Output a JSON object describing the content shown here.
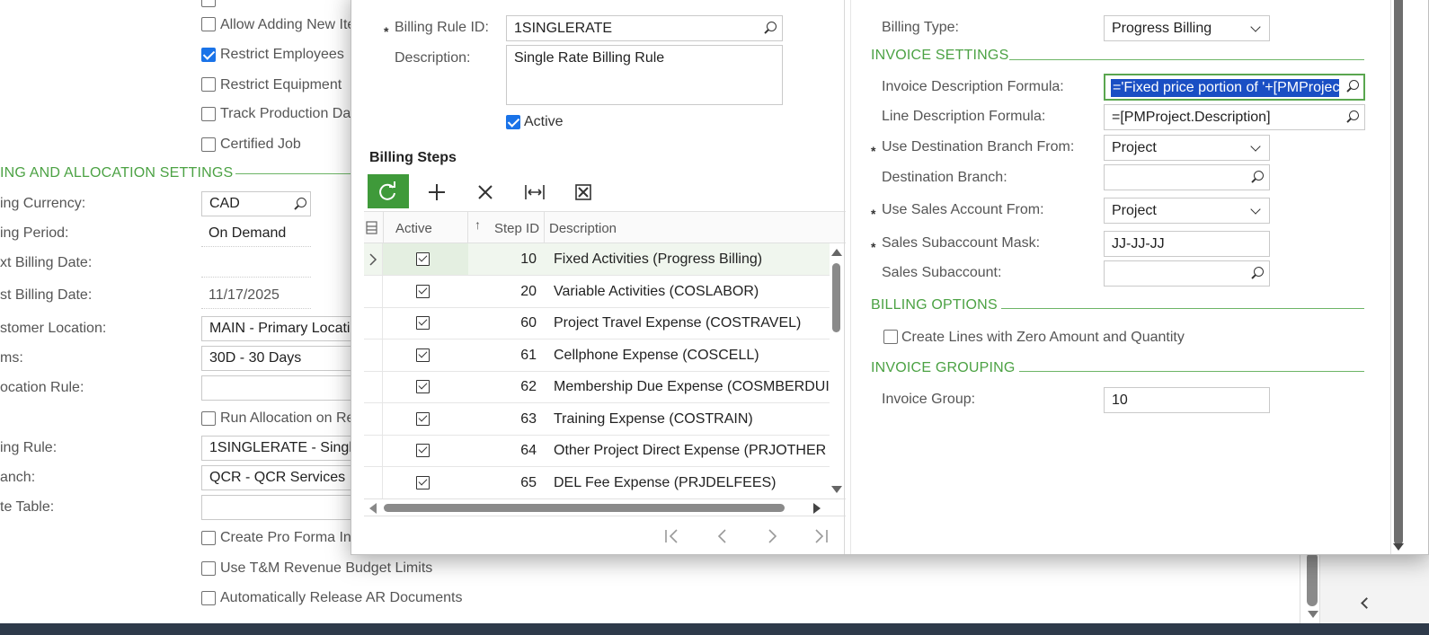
{
  "background": {
    "checkboxes_top": [
      {
        "label": "Allow Adding New Ite",
        "checked": false
      },
      {
        "label": "Restrict Employees",
        "checked": true
      },
      {
        "label": "Restrict Equipment",
        "checked": false
      },
      {
        "label": "Track Production Da",
        "checked": false
      },
      {
        "label": "Certified Job",
        "checked": false
      }
    ],
    "section_title": "ING AND ALLOCATION SETTINGS",
    "fields": [
      {
        "label": "ing Currency:",
        "value": "CAD"
      },
      {
        "label": "ing Period:",
        "value": "On Demand"
      },
      {
        "label": "xt Billing Date:",
        "value": ""
      },
      {
        "label": "st Billing Date:",
        "value": "11/17/2025"
      },
      {
        "label": "stomer Location:",
        "value": "MAIN - Primary Locati"
      },
      {
        "label": "ms:",
        "value": "30D - 30 Days"
      },
      {
        "label": "ocation Rule:",
        "value": ""
      },
      {
        "label": "ing Rule:",
        "value": "1SINGLERATE - Singl"
      },
      {
        "label": "anch:",
        "value": "QCR - QCR Services"
      },
      {
        "label": "te Table:",
        "value": ""
      }
    ],
    "run_allocation_label": "Run Allocation on Re",
    "checkboxes_bottom": [
      {
        "label": "Create Pro Forma In",
        "checked": false
      },
      {
        "label": "Use T&M Revenue Budget Limits",
        "checked": false
      },
      {
        "label": "Automatically Release AR Documents",
        "checked": false
      }
    ]
  },
  "dialog": {
    "billing_rule_id_label": "Billing Rule ID:",
    "billing_rule_id_value": "1SINGLERATE",
    "description_label": "Description:",
    "description_value": "Single Rate Billing Rule",
    "active_label": "Active",
    "billing_steps_title": "Billing Steps",
    "grid": {
      "col_active": "Active",
      "col_step_id": "Step ID",
      "col_description": "Description",
      "sort_arrow": "↑",
      "rows": [
        {
          "step_id": "10",
          "description": "Fixed Activities (Progress Billing)"
        },
        {
          "step_id": "20",
          "description": "Variable Activities (COSLABOR)"
        },
        {
          "step_id": "60",
          "description": "Project Travel Expense (COSTRAVEL)"
        },
        {
          "step_id": "61",
          "description": "Cellphone Expense (COSCELL)"
        },
        {
          "step_id": "62",
          "description": "Membership Due Expense (COSMBERDUI"
        },
        {
          "step_id": "63",
          "description": "Training Expense (COSTRAIN)"
        },
        {
          "step_id": "64",
          "description": "Other Project Direct Expense (PRJOTHER"
        },
        {
          "step_id": "65",
          "description": "DEL Fee Expense (PRJDELFEES)"
        }
      ]
    },
    "right": {
      "billing_type_label": "Billing Type:",
      "billing_type_value": "Progress Billing",
      "invoice_settings_title": "INVOICE SETTINGS",
      "invoice_desc_formula_label": "Invoice Description Formula:",
      "invoice_desc_formula_value": "='Fixed price portion of '+[PMProjec",
      "line_desc_formula_label": "Line Description Formula:",
      "line_desc_formula_value": "=[PMProject.Description]",
      "dest_branch_from_label": "Use Destination Branch From:",
      "dest_branch_from_value": "Project",
      "dest_branch_label": "Destination Branch:",
      "dest_branch_value": "",
      "sales_account_from_label": "Use Sales Account From:",
      "sales_account_from_value": "Project",
      "sales_sub_mask_label": "Sales Subaccount Mask:",
      "sales_sub_mask_value": "JJ-JJ-JJ",
      "sales_sub_label": "Sales Subaccount:",
      "sales_sub_value": "",
      "billing_options_title": "BILLING OPTIONS",
      "zero_amount_label": "Create Lines with Zero Amount and Quantity",
      "invoice_grouping_title": "INVOICE GROUPING",
      "invoice_group_label": "Invoice Group:",
      "invoice_group_value": "10"
    },
    "required_mark": "*"
  },
  "colors": {
    "accent_green": "#4ca244",
    "selection_blue": "#1a73e8",
    "toolbar_green": "#3f9a3a"
  }
}
